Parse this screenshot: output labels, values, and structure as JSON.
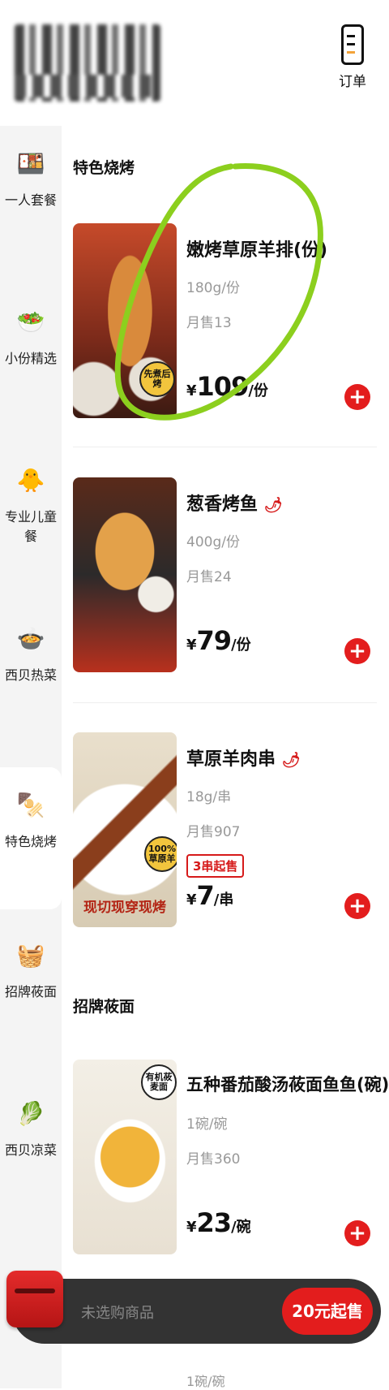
{
  "header": {
    "order_label": "订单"
  },
  "sidebar": {
    "items": [
      {
        "label": "一人套餐",
        "icon": "meal-set-icon",
        "emoji": "🍱"
      },
      {
        "label": "小份精选",
        "icon": "small-plate-icon",
        "emoji": "🥗"
      },
      {
        "label": "专业儿童餐",
        "icon": "kids-meal-icon",
        "emoji": "🐥"
      },
      {
        "label": "西贝热菜",
        "icon": "hot-dish-icon",
        "emoji": "🍲"
      },
      {
        "label": "特色烧烤",
        "icon": "skewer-icon",
        "emoji": "🍢"
      },
      {
        "label": "招牌莜面",
        "icon": "steamer-icon",
        "emoji": "🧺"
      },
      {
        "label": "西贝凉菜",
        "icon": "cold-dish-icon",
        "emoji": "🥬"
      }
    ],
    "active_index": 4
  },
  "sections": {
    "bbq_title": "特色烧烤",
    "noodle_title": "招牌莜面"
  },
  "products": [
    {
      "name": "嫩烤草原羊排(份)",
      "spec": "180g/份",
      "sold": "月售13",
      "currency": "¥",
      "price": "109",
      "unit": "/份",
      "badge": "先煮后烤"
    },
    {
      "name": "葱香烤鱼",
      "spec": "400g/份",
      "sold": "月售24",
      "currency": "¥",
      "price": "79",
      "unit": "/份",
      "spicy": true
    },
    {
      "name": "草原羊肉串",
      "spec": "18g/串",
      "sold": "月售907",
      "currency": "¥",
      "price": "7",
      "unit": "/串",
      "spicy": true,
      "tag": "3串起售",
      "badge": "100%草原羊",
      "caption": "现切现穿现烤"
    },
    {
      "name": "五种番茄酸汤莜面鱼鱼(碗)",
      "spec": "1碗/碗",
      "sold": "月售360",
      "currency": "¥",
      "price": "23",
      "unit": "/碗",
      "badge": "有机莜麦面"
    }
  ],
  "cart": {
    "empty_text": "未选购商品",
    "min_order": "20元起售"
  },
  "peek": {
    "spec": "1碗/碗"
  },
  "colors": {
    "accent": "#e31d1d",
    "annotation": "#8ccf1e"
  }
}
